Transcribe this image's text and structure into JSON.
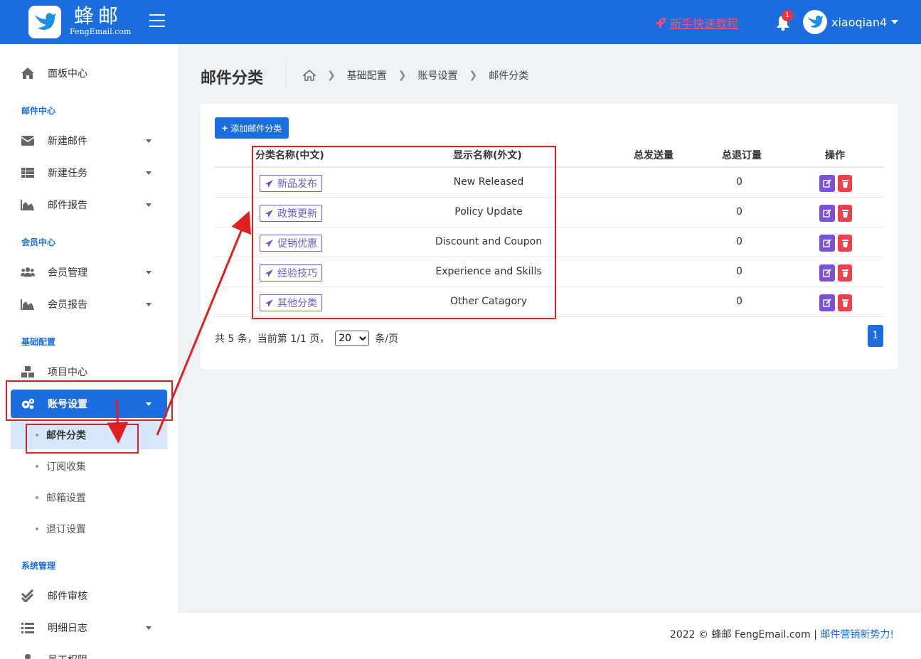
{
  "header": {
    "logo_name": "蜂邮",
    "logo_sub": "FengEmail.com",
    "tutorial_label": "新手快速教程",
    "notification_count": "1",
    "username": "xiaoqian4"
  },
  "sidebar": {
    "dashboard": "面板中心",
    "sections": {
      "mail": "邮件中心",
      "member": "会员中心",
      "base": "基础配置",
      "system": "系统管理"
    },
    "items": {
      "new_mail": "新建邮件",
      "new_task": "新建任务",
      "mail_report": "邮件报告",
      "member_manage": "会员管理",
      "member_report": "会员报告",
      "project_center": "项目中心",
      "account_settings": "账号设置",
      "mail_audit": "邮件审核",
      "detail_log": "明细日志",
      "staff_perm": "员工权限"
    },
    "sub_items": {
      "mail_category": "邮件分类",
      "subscribe_collect": "订阅收集",
      "mailbox_settings": "邮箱设置",
      "unsubscribe_settings": "退订设置"
    }
  },
  "page": {
    "title": "邮件分类",
    "breadcrumb": [
      "基础配置",
      "账号设置",
      "邮件分类"
    ],
    "add_button": "添加邮件分类"
  },
  "table": {
    "columns": {
      "name_cn": "分类名称(中文)",
      "name_foreign": "显示名称(外文)",
      "total_sent": "总发送量",
      "total_unsub": "总退订量",
      "actions": "操作"
    },
    "rows": [
      {
        "name_cn": "新品发布",
        "name_foreign": "New Released",
        "total_unsub": "0"
      },
      {
        "name_cn": "政策更新",
        "name_foreign": "Policy Update",
        "total_unsub": "0"
      },
      {
        "name_cn": "促销优惠",
        "name_foreign": "Discount and Coupon",
        "total_unsub": "0"
      },
      {
        "name_cn": "经验技巧",
        "name_foreign": "Experience and Skills",
        "total_unsub": "0"
      },
      {
        "name_cn": "其他分类",
        "name_foreign": "Other Catagory",
        "total_unsub": "0"
      }
    ]
  },
  "pagination": {
    "summary": "共 5 条，当前第 1/1 页，",
    "page_size": "20",
    "per_page_suffix": "条/页",
    "current_page": "1"
  },
  "footer": {
    "copyright": "2022 © 蜂邮 FengEmail.com |",
    "slogan": "邮件营销新势力!"
  },
  "colors": {
    "primary": "#1c6ee0",
    "tag_purple": "#6a5acd",
    "edit_purple": "#7952d8",
    "delete_red": "#f0404e",
    "annotation_red": "#e02020",
    "tutorial_red": "#ff4d6a"
  }
}
